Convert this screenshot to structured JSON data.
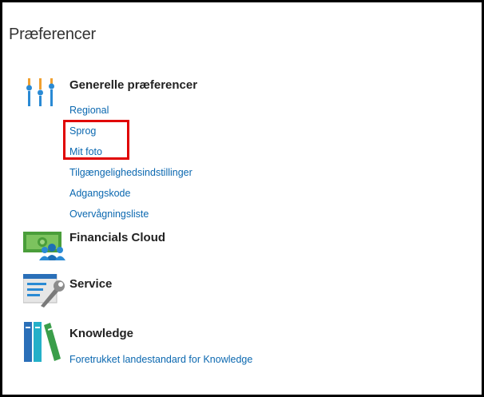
{
  "page": {
    "title": "Præferencer"
  },
  "sections": [
    {
      "title": "Generelle præferencer",
      "icon": "sliders-icon",
      "links": [
        "Regional",
        "Sprog",
        "Mit foto",
        "Tilgængelighedsindstillinger",
        "Adgangskode",
        "Overvågningsliste"
      ]
    },
    {
      "title": "Financials Cloud",
      "icon": "money-people-icon",
      "links": []
    },
    {
      "title": "Service",
      "icon": "form-wrench-icon",
      "links": []
    },
    {
      "title": "Knowledge",
      "icon": "books-icon",
      "links": [
        "Foretrukket landestandard for Knowledge"
      ]
    }
  ],
  "colors": {
    "link": "#0b68b0",
    "highlight": "#e00000",
    "slider_blue": "#2a8ad4",
    "slider_orange": "#f0a030"
  }
}
